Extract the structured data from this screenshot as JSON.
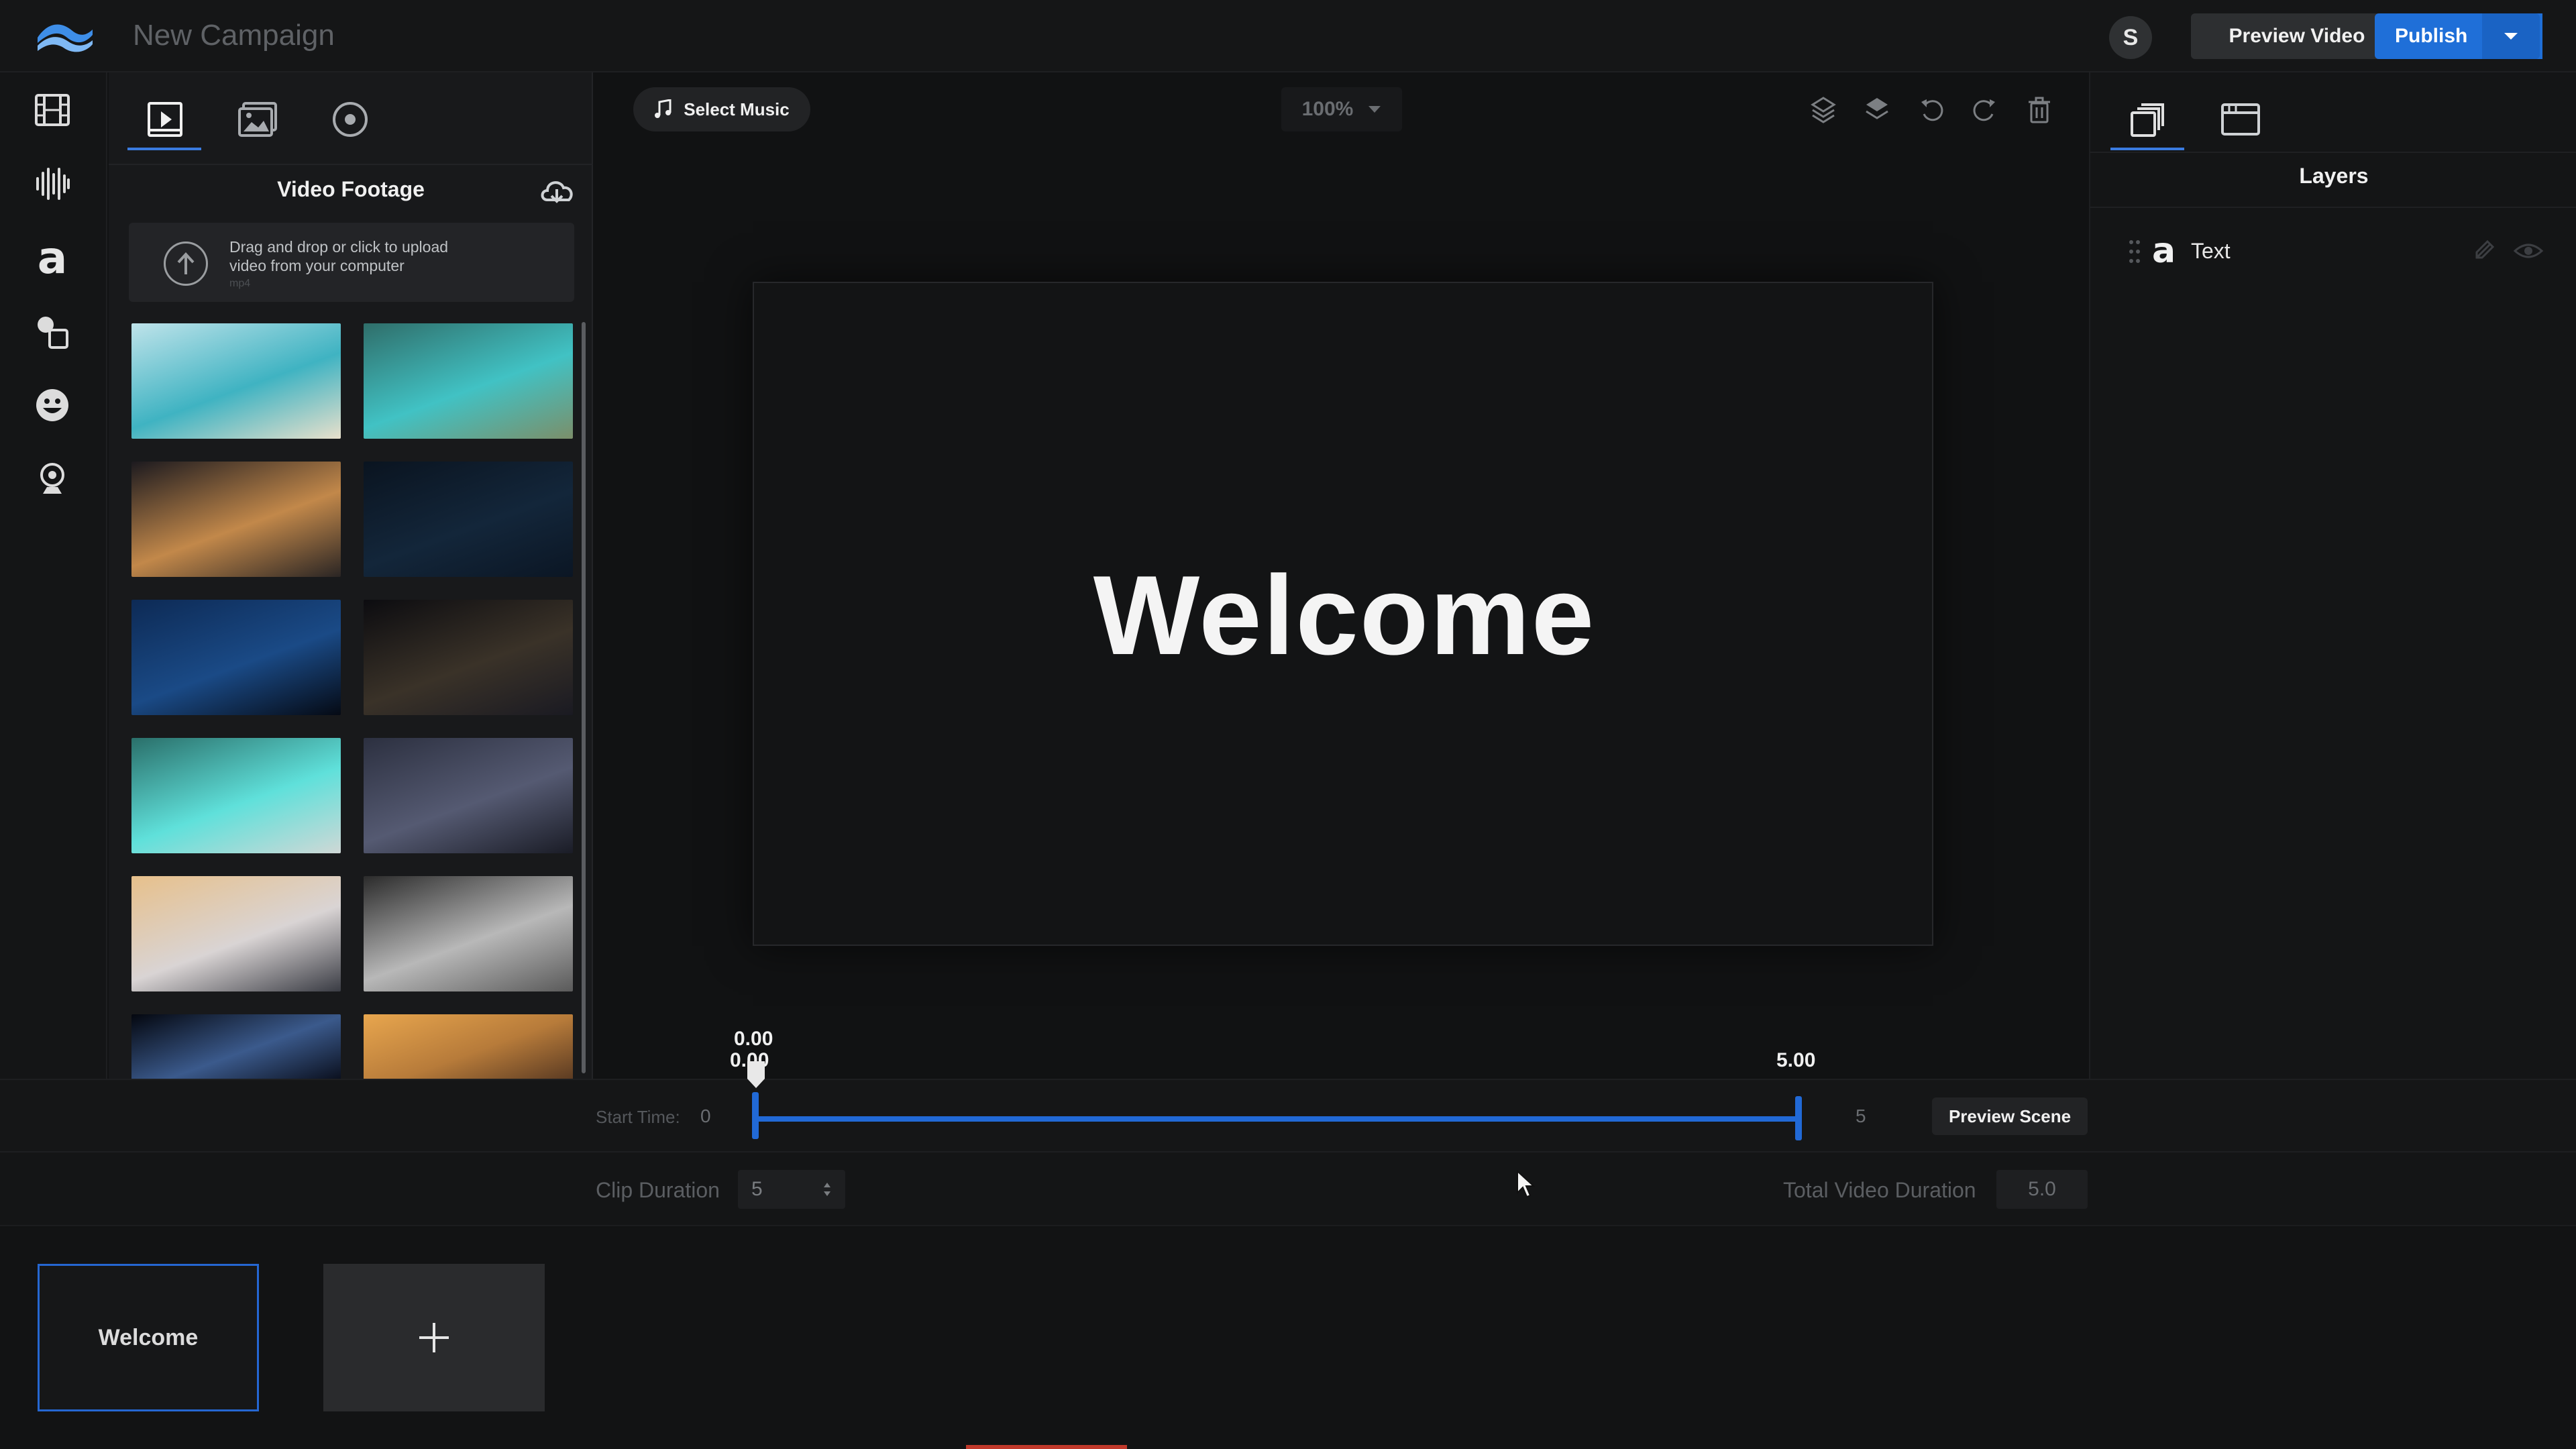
{
  "app": {
    "title": "New Campaign",
    "user_initial": "S"
  },
  "header": {
    "preview_video_label": "Preview Video",
    "publish_label": "Publish"
  },
  "left_rail": {
    "icons": [
      "film-icon",
      "audio-bars-icon",
      "text-a-icon",
      "shapes-icon",
      "emoji-icon",
      "webcam-icon"
    ]
  },
  "library": {
    "tabs": [
      "video-tab-icon",
      "image-tab-icon",
      "circle-record-icon"
    ],
    "title": "Video Footage",
    "upload_text": "Drag and drop or click to upload video from your computer",
    "upload_sub": "mp4",
    "thumbnails": [
      {
        "colors": [
          "#bfe3ea",
          "#3fb3c2",
          "#e8e0cc"
        ]
      },
      {
        "colors": [
          "#2f6e6a",
          "#41c2c4",
          "#7b8f6a"
        ]
      },
      {
        "colors": [
          "#1c1a1f",
          "#c2884a",
          "#2a2524"
        ]
      },
      {
        "colors": [
          "#0a1420",
          "#13263a",
          "#0b1624"
        ]
      },
      {
        "colors": [
          "#0d2a55",
          "#1a4a86",
          "#050a14"
        ]
      },
      {
        "colors": [
          "#0c0c10",
          "#3a3228",
          "#1a1a22"
        ]
      },
      {
        "colors": [
          "#2a6f6a",
          "#5fe0da",
          "#cfd8d6"
        ]
      },
      {
        "colors": [
          "#2c3040",
          "#555a72",
          "#1a1c26"
        ]
      },
      {
        "colors": [
          "#e7c08b",
          "#d9d4d4",
          "#3a3c44"
        ]
      },
      {
        "colors": [
          "#2b2b2b",
          "#b8b8b8",
          "#5a5a5a"
        ]
      },
      {
        "colors": [
          "#04070f",
          "#3b5a8c",
          "#0a0f1d"
        ]
      },
      {
        "colors": [
          "#e8a64e",
          "#b77b3a",
          "#5a3a22"
        ]
      }
    ]
  },
  "stage": {
    "select_music_label": "Select Music",
    "zoom": "100%",
    "canvas_text": "Welcome"
  },
  "right_panel": {
    "title": "Layers",
    "layers": [
      {
        "name": "Text",
        "type_glyph": "a"
      }
    ]
  },
  "timeline": {
    "current_time_top": "0.00",
    "current_time_bottom": "0.00",
    "end_time_label": "5.00",
    "start_time_label": "Start Time:",
    "start_time_value": "0",
    "end_time_value": "5",
    "preview_scene_label": "Preview Scene",
    "clip_duration_label": "Clip Duration",
    "clip_duration_value": "5",
    "total_duration_label": "Total Video Duration",
    "total_duration_value": "5.0"
  },
  "scenes": {
    "items": [
      {
        "label": "Welcome"
      }
    ]
  },
  "colors": {
    "accent": "#2169d6",
    "publish": "#1f6fd8",
    "background": "#111213"
  }
}
